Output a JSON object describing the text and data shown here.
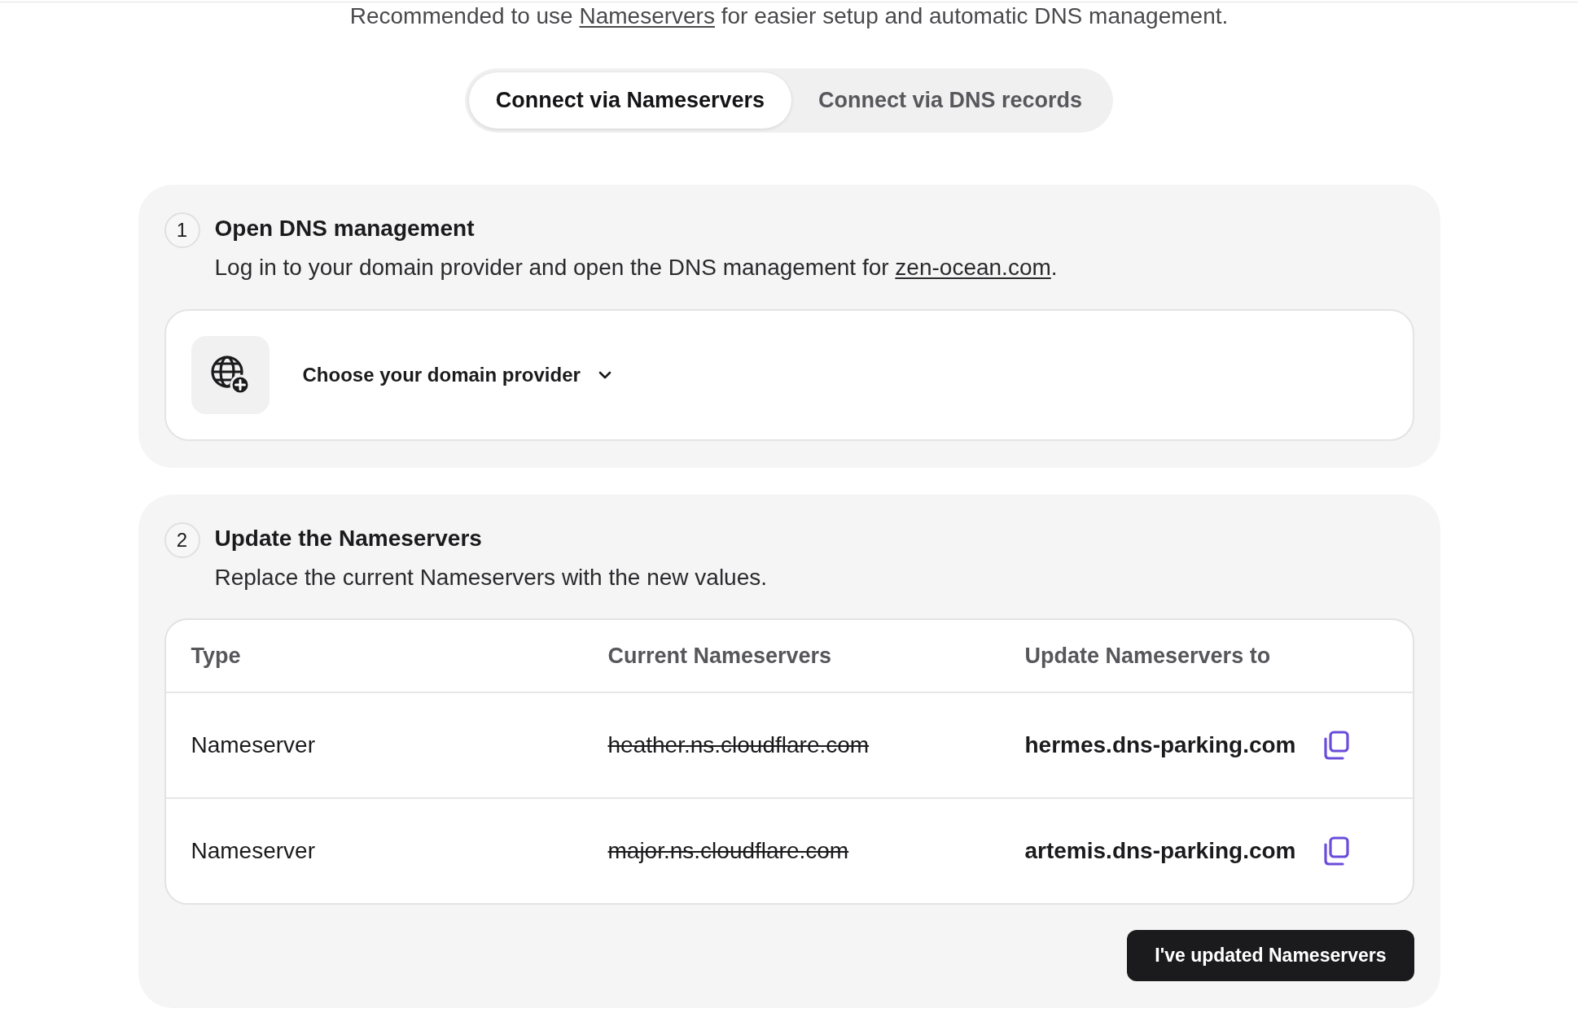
{
  "intro": {
    "parts": [
      {
        "kind": "text",
        "text": "Recommended to use "
      },
      {
        "kind": "link",
        "text": "Nameservers"
      },
      {
        "kind": "text",
        "text": " for easier setup and automatic DNS management."
      }
    ]
  },
  "connection_tabs": [
    {
      "label": "Connect via Nameservers",
      "selected": true
    },
    {
      "label": "Connect via DNS records",
      "selected": false
    }
  ],
  "steps": [
    {
      "number": "1",
      "title": "Open DNS management",
      "description": [
        {
          "kind": "text",
          "text": "Log in to your domain provider and open the DNS management for "
        },
        {
          "kind": "link",
          "text": "zen-ocean.com"
        },
        {
          "kind": "text",
          "text": "."
        }
      ],
      "kind": "provider_select",
      "provider_select": {
        "label": "Choose your domain provider"
      }
    },
    {
      "number": "2",
      "title": "Update the Nameservers",
      "description": [
        {
          "kind": "text",
          "text": "Replace the current Nameservers with the new values."
        }
      ],
      "kind": "nameserver_table",
      "table": {
        "columns": [
          "Type",
          "Current Nameservers",
          "Update Nameservers to"
        ],
        "rows": [
          {
            "type": "Nameserver",
            "current_nameserver": "heather.ns.cloudflare.com",
            "new_nameserver": "hermes.dns-parking.com"
          },
          {
            "type": "Nameserver",
            "current_nameserver": "major.ns.cloudflare.com",
            "new_nameserver": "artemis.dns-parking.com"
          }
        ]
      },
      "action_button": {
        "label": "I've updated Nameservers"
      }
    }
  ]
}
